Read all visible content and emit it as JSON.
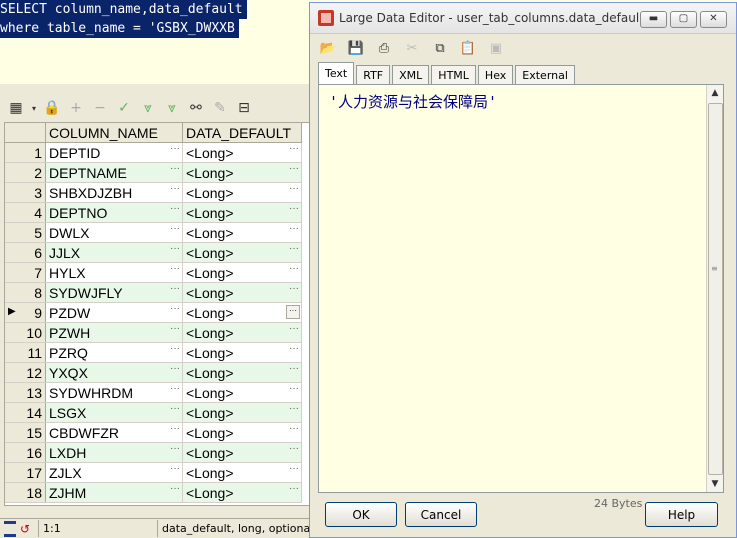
{
  "sql": {
    "line1": "SELECT column_name,data_default",
    "line2": "where table_name = 'GSBX_DWXXB"
  },
  "grid": {
    "columns": [
      "COLUMN_NAME",
      "DATA_DEFAULT"
    ],
    "rows": [
      {
        "n": "1",
        "name": "DEPTID",
        "def": "<Long>"
      },
      {
        "n": "2",
        "name": "DEPTNAME",
        "def": "<Long>"
      },
      {
        "n": "3",
        "name": "SHBXDJZBH",
        "def": "<Long>"
      },
      {
        "n": "4",
        "name": "DEPTNO",
        "def": "<Long>"
      },
      {
        "n": "5",
        "name": "DWLX",
        "def": "<Long>"
      },
      {
        "n": "6",
        "name": "JJLX",
        "def": "<Long>"
      },
      {
        "n": "7",
        "name": "HYLX",
        "def": "<Long>"
      },
      {
        "n": "8",
        "name": "SYDWJFLY",
        "def": "<Long>"
      },
      {
        "n": "9",
        "name": "PZDW",
        "def": "<Long>"
      },
      {
        "n": "10",
        "name": "PZWH",
        "def": "<Long>"
      },
      {
        "n": "11",
        "name": "PZRQ",
        "def": "<Long>"
      },
      {
        "n": "12",
        "name": "YXQX",
        "def": "<Long>"
      },
      {
        "n": "13",
        "name": "SYDWHRDM",
        "def": "<Long>"
      },
      {
        "n": "14",
        "name": "LSGX",
        "def": "<Long>"
      },
      {
        "n": "15",
        "name": "CBDWFZR",
        "def": "<Long>"
      },
      {
        "n": "16",
        "name": "LXDH",
        "def": "<Long>"
      },
      {
        "n": "17",
        "name": "ZJLX",
        "def": "<Long>"
      },
      {
        "n": "18",
        "name": "ZJHM",
        "def": "<Long>"
      }
    ],
    "current_row": 9,
    "dots": "···",
    "dotbtn": "···"
  },
  "status": {
    "position": "1:1",
    "info": "data_default, long, optional, De"
  },
  "dialog": {
    "title": "Large Data Editor - user_tab_columns.data_defaul...",
    "tabs": [
      "Text",
      "RTF",
      "XML",
      "HTML",
      "Hex",
      "External"
    ],
    "active_tab": "Text",
    "content": "'人力资源与社会保障局'",
    "bytes": "24 Bytes",
    "ok_label": "OK",
    "cancel_label": "Cancel",
    "help_label": "Help"
  }
}
